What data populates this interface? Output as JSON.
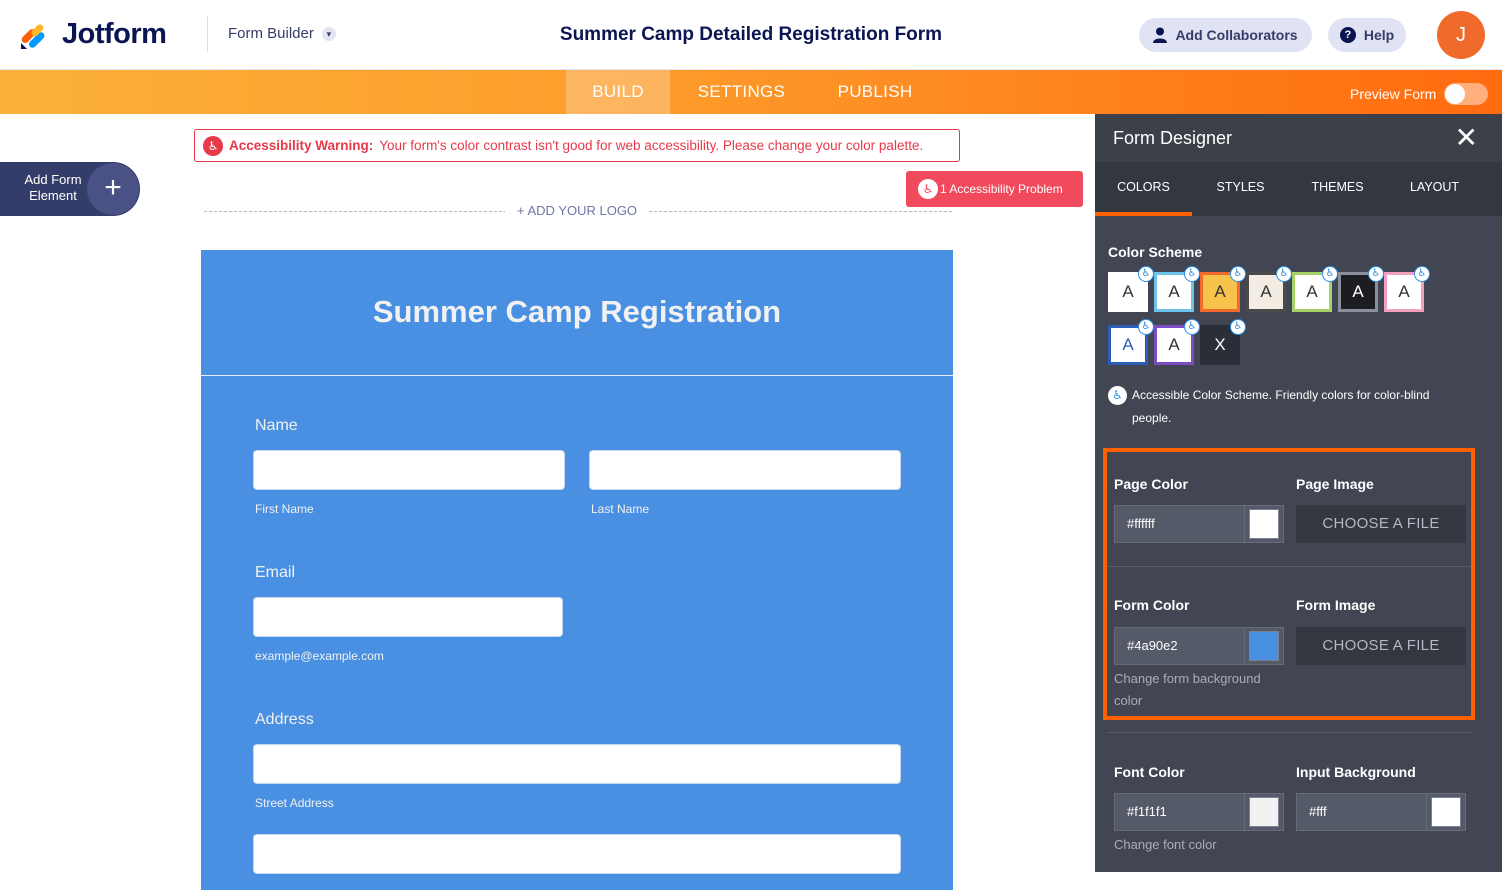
{
  "header": {
    "brand": "Jotform",
    "builder_menu": "Form Builder",
    "form_title": "Summer Camp Detailed Registration Form",
    "add_collaborators": "Add Collaborators",
    "help": "Help",
    "avatar_initial": "J"
  },
  "nav": {
    "tabs": [
      {
        "label": "BUILD",
        "active": true
      },
      {
        "label": "SETTINGS",
        "active": false
      },
      {
        "label": "PUBLISH",
        "active": false
      }
    ],
    "preview_label": "Preview Form",
    "preview_on": false
  },
  "canvas": {
    "warning_title": "Accessibility Warning:",
    "warning_text": "Your form's color contrast isn't good for web accessibility. Please change your color palette.",
    "accessibility_problem": "1 Accessibility Problem",
    "add_element_line1": "Add Form",
    "add_element_line2": "Element",
    "add_logo": "+ ADD YOUR LOGO"
  },
  "form": {
    "heading": "Summer Camp Registration",
    "name_label": "Name",
    "first_name": "First Name",
    "last_name": "Last Name",
    "email_label": "Email",
    "email_sub": "example@example.com",
    "address_label": "Address",
    "street_address": "Street Address",
    "background": "#4a90e2",
    "font_color": "#f1f1f1"
  },
  "panel": {
    "title": "Form Designer",
    "tabs": [
      {
        "label": "COLORS",
        "active": true
      },
      {
        "label": "STYLES",
        "active": false
      },
      {
        "label": "THEMES",
        "active": false
      },
      {
        "label": "LAYOUT",
        "active": false
      }
    ],
    "color_scheme_title": "Color Scheme",
    "swatches": [
      {
        "letter": "A",
        "bg": "#ffffff",
        "border": "#ffffff",
        "color": "#333333",
        "accessible": true
      },
      {
        "letter": "A",
        "bg": "#ffffff",
        "border": "#6dc3e8",
        "color": "#333333",
        "accessible": true
      },
      {
        "letter": "A",
        "bg": "#f7c34c",
        "border": "#f06a2b",
        "color": "#333333",
        "accessible": true
      },
      {
        "letter": "A",
        "bg": "#f3ece3",
        "border": "#4a4a4a",
        "color": "#333333",
        "accessible": true
      },
      {
        "letter": "A",
        "bg": "#ffffff",
        "border": "#a6d26a",
        "color": "#333333",
        "accessible": true
      },
      {
        "letter": "A",
        "bg": "#1b1d22",
        "border": "#8a8f9a",
        "color": "#ffffff",
        "accessible": true
      },
      {
        "letter": "A",
        "bg": "#ffffff",
        "border": "#f2a0c0",
        "color": "#333333",
        "accessible": true
      },
      {
        "letter": "A",
        "bg": "#ffffff",
        "border": "#2a5cb8",
        "color": "#2a5cb8",
        "accessible": true
      },
      {
        "letter": "A",
        "bg": "#ffffff",
        "border": "#7b4cc4",
        "color": "#333333",
        "accessible": true
      },
      {
        "letter": "X",
        "bg": "#2b2e36",
        "border": "#2b2e36",
        "color": "#ffffff",
        "accessible": true
      }
    ],
    "a11y_note": "Accessible Color Scheme. Friendly colors for color-blind people.",
    "page_color_label": "Page Color",
    "page_color_value": "#ffffff",
    "page_color_chip": "#ffffff",
    "page_image_label": "Page Image",
    "choose_file": "CHOOSE A FILE",
    "form_color_label": "Form Color",
    "form_color_value": "#4a90e2",
    "form_color_chip": "#4a90e2",
    "form_color_help": "Change form background color",
    "form_image_label": "Form Image",
    "font_color_label": "Font Color",
    "font_color_value": "#f1f1f1",
    "font_color_chip": "#f1f1f1",
    "font_color_help": "Change font color",
    "input_bg_label": "Input Background",
    "input_bg_value": "#fff",
    "input_bg_chip": "#ffffff"
  },
  "colors": {
    "accent": "#ff6100",
    "warning": "#e8394b"
  }
}
